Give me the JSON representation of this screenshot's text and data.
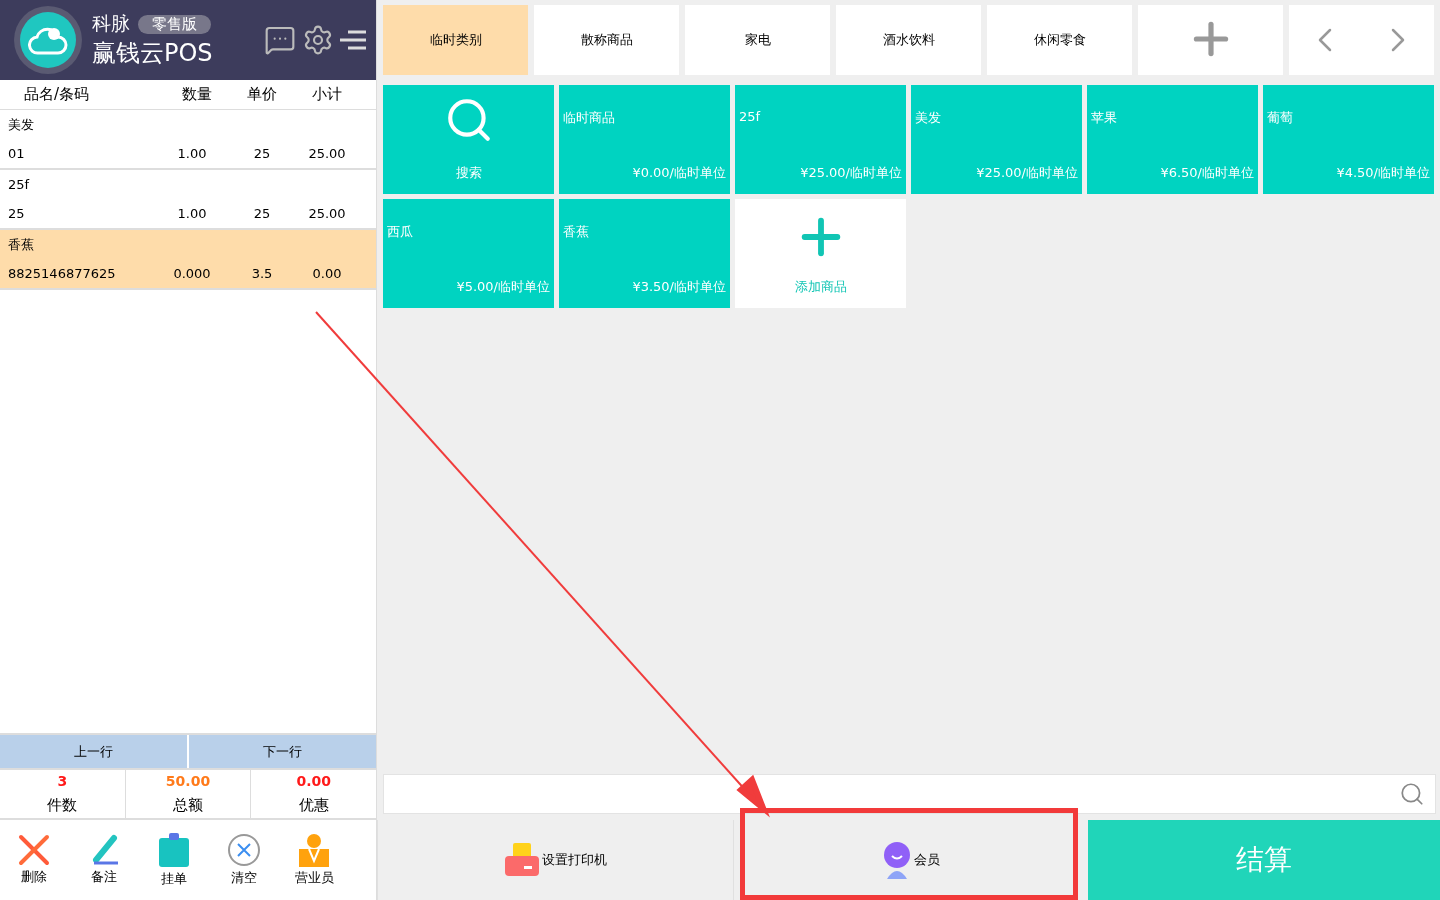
{
  "header": {
    "brand": "科脉",
    "edition": "零售版",
    "product": "赢钱云POS"
  },
  "cart": {
    "columns": [
      "品名/条码",
      "数量",
      "单价",
      "小计"
    ],
    "items": [
      {
        "name": "美发",
        "code": "01",
        "qty": "1.00",
        "price": "25",
        "subtotal": "25.00",
        "selected": false
      },
      {
        "name": "25f",
        "code": "25",
        "qty": "1.00",
        "price": "25",
        "subtotal": "25.00",
        "selected": false
      },
      {
        "name": "香蕉",
        "code": "8825146877625",
        "qty": "0.000",
        "price": "3.5",
        "subtotal": "0.00",
        "selected": true
      }
    ]
  },
  "nav_buttons": [
    "上一行",
    "下一行"
  ],
  "summary": [
    {
      "value": "3",
      "label": "件数",
      "color": "#ff1a1a"
    },
    {
      "value": "50.00",
      "label": "总额",
      "color": "#ff7a1a"
    },
    {
      "value": "0.00",
      "label": "优惠",
      "color": "#ff1a1a"
    }
  ],
  "toolbar": [
    {
      "kind": "delete",
      "label": "删除"
    },
    {
      "kind": "note",
      "label": "备注"
    },
    {
      "kind": "hold",
      "label": "挂单"
    },
    {
      "kind": "clear",
      "label": "清空"
    },
    {
      "kind": "staff",
      "label": "营业员"
    }
  ],
  "categories": [
    {
      "label": "临时类别",
      "selected": true
    },
    {
      "label": "散称商品",
      "selected": false
    },
    {
      "label": "家电",
      "selected": false
    },
    {
      "label": "酒水饮料",
      "selected": false
    },
    {
      "label": "休闲零食",
      "selected": false
    }
  ],
  "products": [
    {
      "kind": "search",
      "label": "搜索"
    },
    {
      "kind": "item",
      "name": "临时商品",
      "price": "¥0.00/临时单位"
    },
    {
      "kind": "item",
      "name": "25f",
      "price": "¥25.00/临时单位"
    },
    {
      "kind": "item",
      "name": "美发",
      "price": "¥25.00/临时单位"
    },
    {
      "kind": "item",
      "name": "苹果",
      "price": "¥6.50/临时单位"
    },
    {
      "kind": "item",
      "name": "葡萄",
      "price": "¥4.50/临时单位"
    },
    {
      "kind": "item",
      "name": "西瓜",
      "price": "¥5.00/临时单位"
    },
    {
      "kind": "item",
      "name": "香蕉",
      "price": "¥3.50/临时单位"
    },
    {
      "kind": "add",
      "label": "添加商品"
    }
  ],
  "actions": [
    {
      "kind": "printer",
      "label": "设置打印机"
    },
    {
      "kind": "member",
      "label": "会员"
    },
    {
      "kind": "checkout",
      "label": "结算"
    }
  ]
}
